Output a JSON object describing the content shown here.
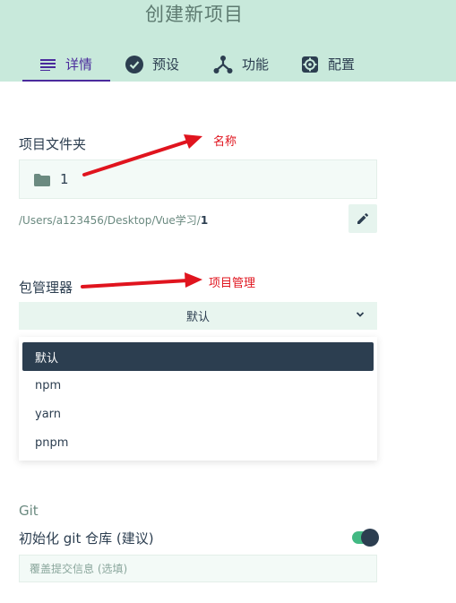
{
  "header": {
    "title": "创建新项目",
    "tabs": [
      {
        "label": "详情",
        "icon": "list-icon",
        "active": true
      },
      {
        "label": "预设",
        "icon": "check-circle-icon",
        "active": false
      },
      {
        "label": "功能",
        "icon": "fork-icon",
        "active": false
      },
      {
        "label": "配置",
        "icon": "gear-icon",
        "active": false
      }
    ]
  },
  "project_folder": {
    "label": "项目文件夹",
    "value": "1",
    "path_prefix": "/Users/a123456/Desktop/Vue学习/",
    "path_name": "1"
  },
  "package_manager": {
    "label": "包管理器",
    "selected": "默认",
    "options": [
      "默认",
      "npm",
      "yarn",
      "pnpm"
    ]
  },
  "git": {
    "section_label": "Git",
    "init_label": "初始化 git 仓库 (建议)",
    "init_enabled": true,
    "commit_placeholder": "覆盖提交信息 (选填)"
  },
  "annotations": {
    "name_note": "名称",
    "manager_note": "项目管理",
    "color": "#e0141e"
  },
  "colors": {
    "header_bg": "#c8e9db",
    "accent": "#4a2a9c",
    "dark": "#2c3e50",
    "toggle_on": "#42b983"
  }
}
